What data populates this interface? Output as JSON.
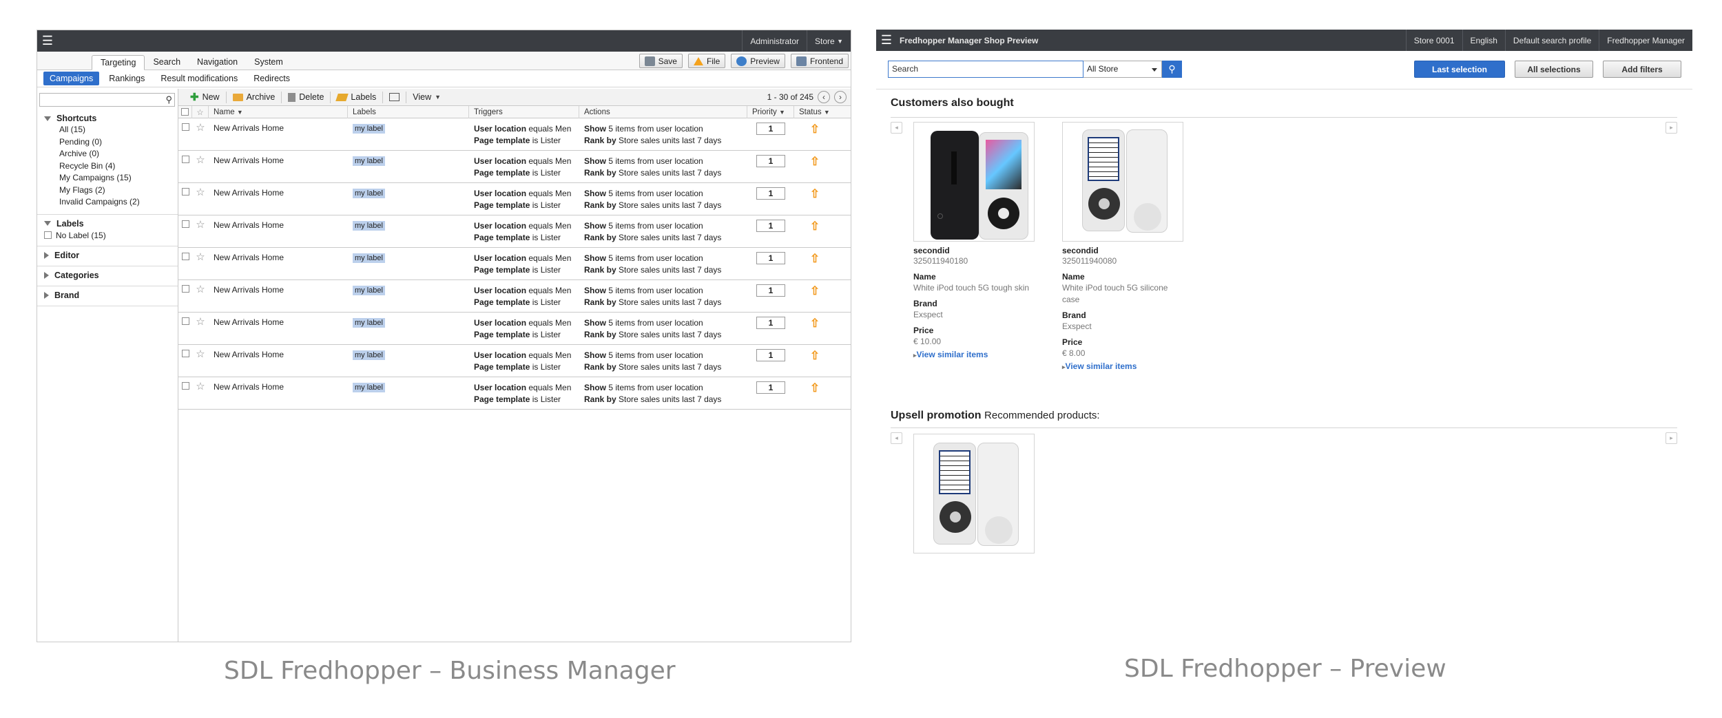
{
  "business_manager": {
    "topbar": {
      "user": "Administrator",
      "store": "Store"
    },
    "main_tabs": [
      "Targeting",
      "Search",
      "Navigation",
      "System"
    ],
    "actions": {
      "save": "Save",
      "file": "File",
      "preview": "Preview",
      "frontend": "Frontend"
    },
    "sub_tabs": [
      "Campaigns",
      "Rankings",
      "Result modifications",
      "Redirects"
    ],
    "sidebar": {
      "shortcuts_title": "Shortcuts",
      "shortcuts": [
        "All (15)",
        "Pending (0)",
        "Archive (0)",
        "Recycle Bin (4)",
        "My Campaigns (15)",
        "My Flags (2)",
        "Invalid Campaigns (2)"
      ],
      "labels_title": "Labels",
      "no_label": "No Label (15)",
      "editor": "Editor",
      "categories": "Categories",
      "brand": "Brand"
    },
    "toolbar": {
      "new": "New",
      "archive": "Archive",
      "delete": "Delete",
      "labels": "Labels",
      "view": "View",
      "pager": "1 - 30 of 245"
    },
    "columns": {
      "name": "Name",
      "labels": "Labels",
      "triggers": "Triggers",
      "actions": "Actions",
      "priority": "Priority",
      "status": "Status"
    },
    "rows": [
      {
        "name": "New Arrivals Home",
        "label": "my label",
        "t1b": "User location",
        "t1": " equals Men",
        "t2b": "Page template",
        "t2": " is Lister",
        "a1b": "Show",
        "a1": " 5 items from user location",
        "a2b": "Rank by",
        "a2": " Store sales units last 7 days",
        "priority": "1"
      },
      {
        "name": "New Arrivals Home",
        "label": "my label",
        "t1b": "User location",
        "t1": " equals Men",
        "t2b": "Page template",
        "t2": " is Lister",
        "a1b": "Show",
        "a1": " 5 items from user location",
        "a2b": "Rank by",
        "a2": " Store sales units last 7 days",
        "priority": "1"
      },
      {
        "name": "New Arrivals Home",
        "label": "my label",
        "t1b": "User location",
        "t1": " equals Men",
        "t2b": "Page template",
        "t2": " is Lister",
        "a1b": "Show",
        "a1": " 5 items from user location",
        "a2b": "Rank by",
        "a2": " Store sales units last 7 days",
        "priority": "1"
      },
      {
        "name": "New Arrivals Home",
        "label": "my label",
        "t1b": "User location",
        "t1": " equals Men",
        "t2b": "Page template",
        "t2": " is Lister",
        "a1b": "Show",
        "a1": " 5 items from user location",
        "a2b": "Rank by",
        "a2": " Store sales units last 7 days",
        "priority": "1"
      },
      {
        "name": "New Arrivals Home",
        "label": "my label",
        "t1b": "User location",
        "t1": " equals Men",
        "t2b": "Page template",
        "t2": " is Lister",
        "a1b": "Show",
        "a1": " 5 items from user location",
        "a2b": "Rank by",
        "a2": " Store sales units last 7 days",
        "priority": "1"
      },
      {
        "name": "New Arrivals Home",
        "label": "my label",
        "t1b": "User location",
        "t1": " equals Men",
        "t2b": "Page template",
        "t2": " is Lister",
        "a1b": "Show",
        "a1": " 5 items from user location",
        "a2b": "Rank by",
        "a2": " Store sales units last 7 days",
        "priority": "1"
      },
      {
        "name": "New Arrivals Home",
        "label": "my label",
        "t1b": "User location",
        "t1": " equals Men",
        "t2b": "Page template",
        "t2": " is Lister",
        "a1b": "Show",
        "a1": " 5 items from user location",
        "a2b": "Rank by",
        "a2": " Store sales units last 7 days",
        "priority": "1"
      },
      {
        "name": "New Arrivals Home",
        "label": "my label",
        "t1b": "User location",
        "t1": " equals Men",
        "t2b": "Page template",
        "t2": " is Lister",
        "a1b": "Show",
        "a1": " 5 items from user location",
        "a2b": "Rank by",
        "a2": " Store sales units last 7 days",
        "priority": "1"
      },
      {
        "name": "New Arrivals Home",
        "label": "my label",
        "t1b": "User location",
        "t1": " equals Men",
        "t2b": "Page template",
        "t2": " is Lister",
        "a1b": "Show",
        "a1": " 5 items from user location",
        "a2b": "Rank by",
        "a2": " Store sales units last 7 days",
        "priority": "1"
      }
    ],
    "caption": "SDL Fredhopper – Business Manager"
  },
  "preview": {
    "topbar": {
      "title": "Fredhopper Manager Shop Preview",
      "store": "Store 0001",
      "language": "English",
      "profile": "Default search profile",
      "manager": "Fredhopper Manager"
    },
    "search": {
      "placeholder": "Search",
      "scope": "All Store"
    },
    "buttons": {
      "last": "Last selection",
      "all": "All selections",
      "filters": "Add filters"
    },
    "also_bought": {
      "title": "Customers also bought",
      "products": [
        {
          "id_label": "secondid",
          "id": "325011940180",
          "name_label": "Name",
          "name": "White iPod touch 5G tough skin",
          "brand_label": "Brand",
          "brand": "Exspect",
          "price_label": "Price",
          "price": "€ 10.00",
          "link": "View similar items"
        },
        {
          "id_label": "secondid",
          "id": "325011940080",
          "name_label": "Name",
          "name": "White iPod touch 5G silicone case",
          "brand_label": "Brand",
          "brand": "Exspect",
          "price_label": "Price",
          "price": "€ 8.00",
          "link": "View similar items"
        }
      ]
    },
    "upsell": {
      "title": "Upsell promotion",
      "subtitle": "Recommended products:"
    },
    "caption": "SDL Fredhopper – Preview"
  },
  "colors": {
    "topbar": "#3a3d42",
    "accent": "#2f6fcb",
    "status_arrow": "#f29a1f"
  }
}
